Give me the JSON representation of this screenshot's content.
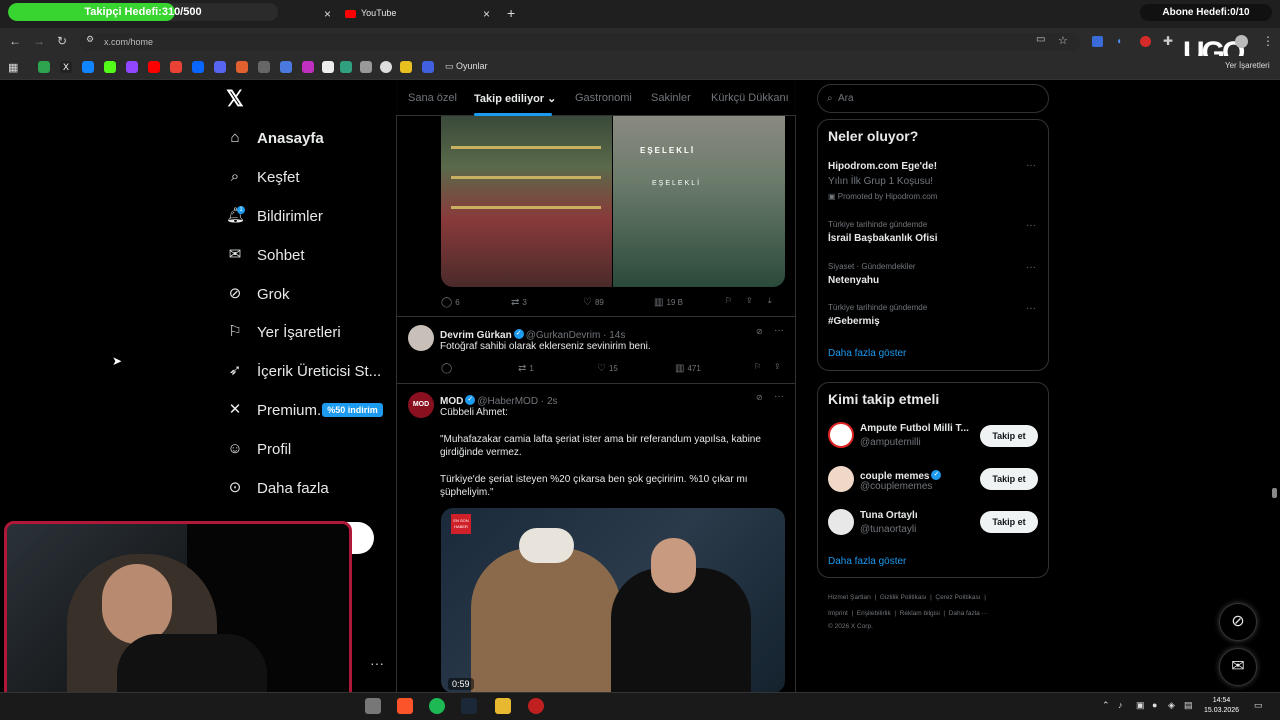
{
  "browser": {
    "tab1_overlay": "Takipçi Hedefi:310/500",
    "tab1_progress": 0.62,
    "tab2_title": "YouTube",
    "new_tab": "+",
    "close": "×",
    "abone": "Abone Hedefi:0/10",
    "address": "x.com/home",
    "bookmark_folder": "Oyunlar",
    "bookmarks_right": "Yer İşaretleri"
  },
  "nav": {
    "items": [
      {
        "label": "Anasayfa",
        "icon": "home-icon"
      },
      {
        "label": "Keşfet",
        "icon": "search-icon"
      },
      {
        "label": "Bildirimler",
        "icon": "bell-icon"
      },
      {
        "label": "Sohbet",
        "icon": "mail-icon"
      },
      {
        "label": "Grok",
        "icon": "grok-icon"
      },
      {
        "label": "Yer İşaretleri",
        "icon": "bookmark-icon"
      },
      {
        "label": "İçerik Üreticisi St...",
        "icon": "rocket-icon"
      },
      {
        "label": "Premium...",
        "icon": "x-icon"
      },
      {
        "label": "Profil",
        "icon": "person-icon"
      },
      {
        "label": "Daha fazla",
        "icon": "more-circle-icon"
      }
    ],
    "notif_count": "1",
    "discount_badge": "%50 indirim"
  },
  "feed": {
    "tabs": [
      "Sana özel",
      "Takip ediliyor",
      "Gastronomi",
      "Sakinler",
      "Kürkçü Dükkanı"
    ],
    "post1_actions": {
      "reply": "6",
      "repost": "3",
      "like": "89",
      "views": "19 B"
    },
    "post1_image_texts": [
      "EŞELEKLİ",
      "EŞELEKLİ"
    ],
    "post2": {
      "name": "Devrim Gürkan",
      "handle": "@GurkanDevrim · 14s",
      "text": "Fotoğraf sahibi olarak eklerseniz sevinirim beni.",
      "reply": "",
      "repost": "1",
      "like": "15",
      "views": "471"
    },
    "post3": {
      "name": "MOD",
      "avatar_text": "MOD",
      "handle": "@HaberMOD · 2s",
      "line1": "Cübbeli Ahmet:",
      "line2": "\"Muhafazakar camia lafta şeriat ister ama bir referandum yapılsa, kabine girdiğinde vermez.",
      "line3": "Türkiye'de şeriat isteyen %20 çıkarsa ben şok geçiririm. %10 çıkar mı şüpheliyim.\"",
      "video_duration": "0:59",
      "video_logo": "EN SON HABER"
    }
  },
  "right": {
    "search_placeholder": "Ara",
    "trends_title": "Neler oluyor?",
    "trends": [
      {
        "meta": "",
        "title": "Hipodrom.com Ege'de!",
        "sub": "Yılın İlk Grup 1 Koşusu!",
        "promo": "Promoted by Hipodrom.com"
      },
      {
        "meta": "Türkiye tarihinde gündemde",
        "title": "İsrail Başbakanlık Ofisi"
      },
      {
        "meta": "Siyaset · Gündemdekiler",
        "title": "Netenyahu"
      },
      {
        "meta": "Türkiye tarihinde gündemde",
        "title": "#Gebermiş"
      }
    ],
    "trends_more": "Daha fazla göster",
    "follow_title": "Kimi takip etmeli",
    "who_to_follow": [
      {
        "name": "Ampute Futbol Milli T...",
        "handle": "@amputemilli",
        "btn": "Takip et"
      },
      {
        "name": "couple memes",
        "handle": "@couplememes",
        "btn": "Takip et"
      },
      {
        "name": "Tuna Ortaylı",
        "handle": "@tunaortayli",
        "btn": "Takip et"
      }
    ],
    "follow_more": "Daha fazla göster",
    "footer_line1": [
      "Hizmet Şartları",
      "Gizlilik Politikası",
      "Çerez Politikası"
    ],
    "footer_line2": [
      "Imprint",
      "Erişilebilirlik",
      "Reklam bilgisi",
      "Daha fazla ···"
    ],
    "copyright": "© 2026 X Corp."
  },
  "taskbar": {
    "time": "14:54",
    "date": "15.03.2026"
  },
  "colors": {
    "accent": "#1d9bf0",
    "webcam_border": "#b0183a",
    "progress": "#38d430"
  }
}
